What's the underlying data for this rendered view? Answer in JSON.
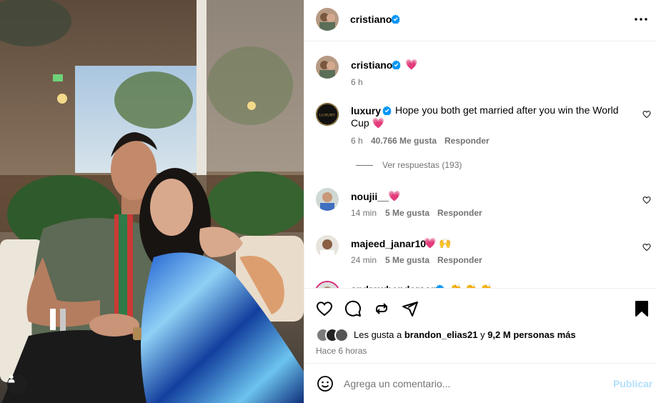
{
  "header": {
    "username": "cristiano",
    "more_icon": "more-horizontal-icon"
  },
  "caption": {
    "username": "cristiano",
    "emoji": "💗",
    "time": "6 h"
  },
  "comments": [
    {
      "username": "luxury",
      "verified": true,
      "avatar_text": "LUXURY",
      "text": "Hope you both get married after you win the World",
      "text2": "Cup 💗",
      "time": "6 h",
      "likes": "40.766 Me gusta",
      "reply": "Responder",
      "view_replies": "Ver respuestas (193)"
    },
    {
      "username": "noujii__",
      "verified": false,
      "text": "💗",
      "time": "14 min",
      "likes": "5 Me gusta",
      "reply": "Responder"
    },
    {
      "username": "majeed_janar10",
      "verified": false,
      "text": "💗 🙌",
      "time": "24 min",
      "likes": "5 Me gusta",
      "reply": "Responder"
    },
    {
      "username": "andrewhenderson",
      "verified": true,
      "text": "👏 👏 👏"
    }
  ],
  "actions": {
    "likes_prefix": "Les gusta a",
    "likes_user": "brandon_elias21",
    "likes_and": "y",
    "likes_rest": "9,2 M personas más",
    "time_ago": "Hace 6 horas"
  },
  "composer": {
    "placeholder": "Agrega un comentario...",
    "post_label": "Publicar"
  },
  "colors": {
    "verified": "#0095f6",
    "heart": "#ff3040",
    "publish_disabled": "#b2dffc"
  }
}
